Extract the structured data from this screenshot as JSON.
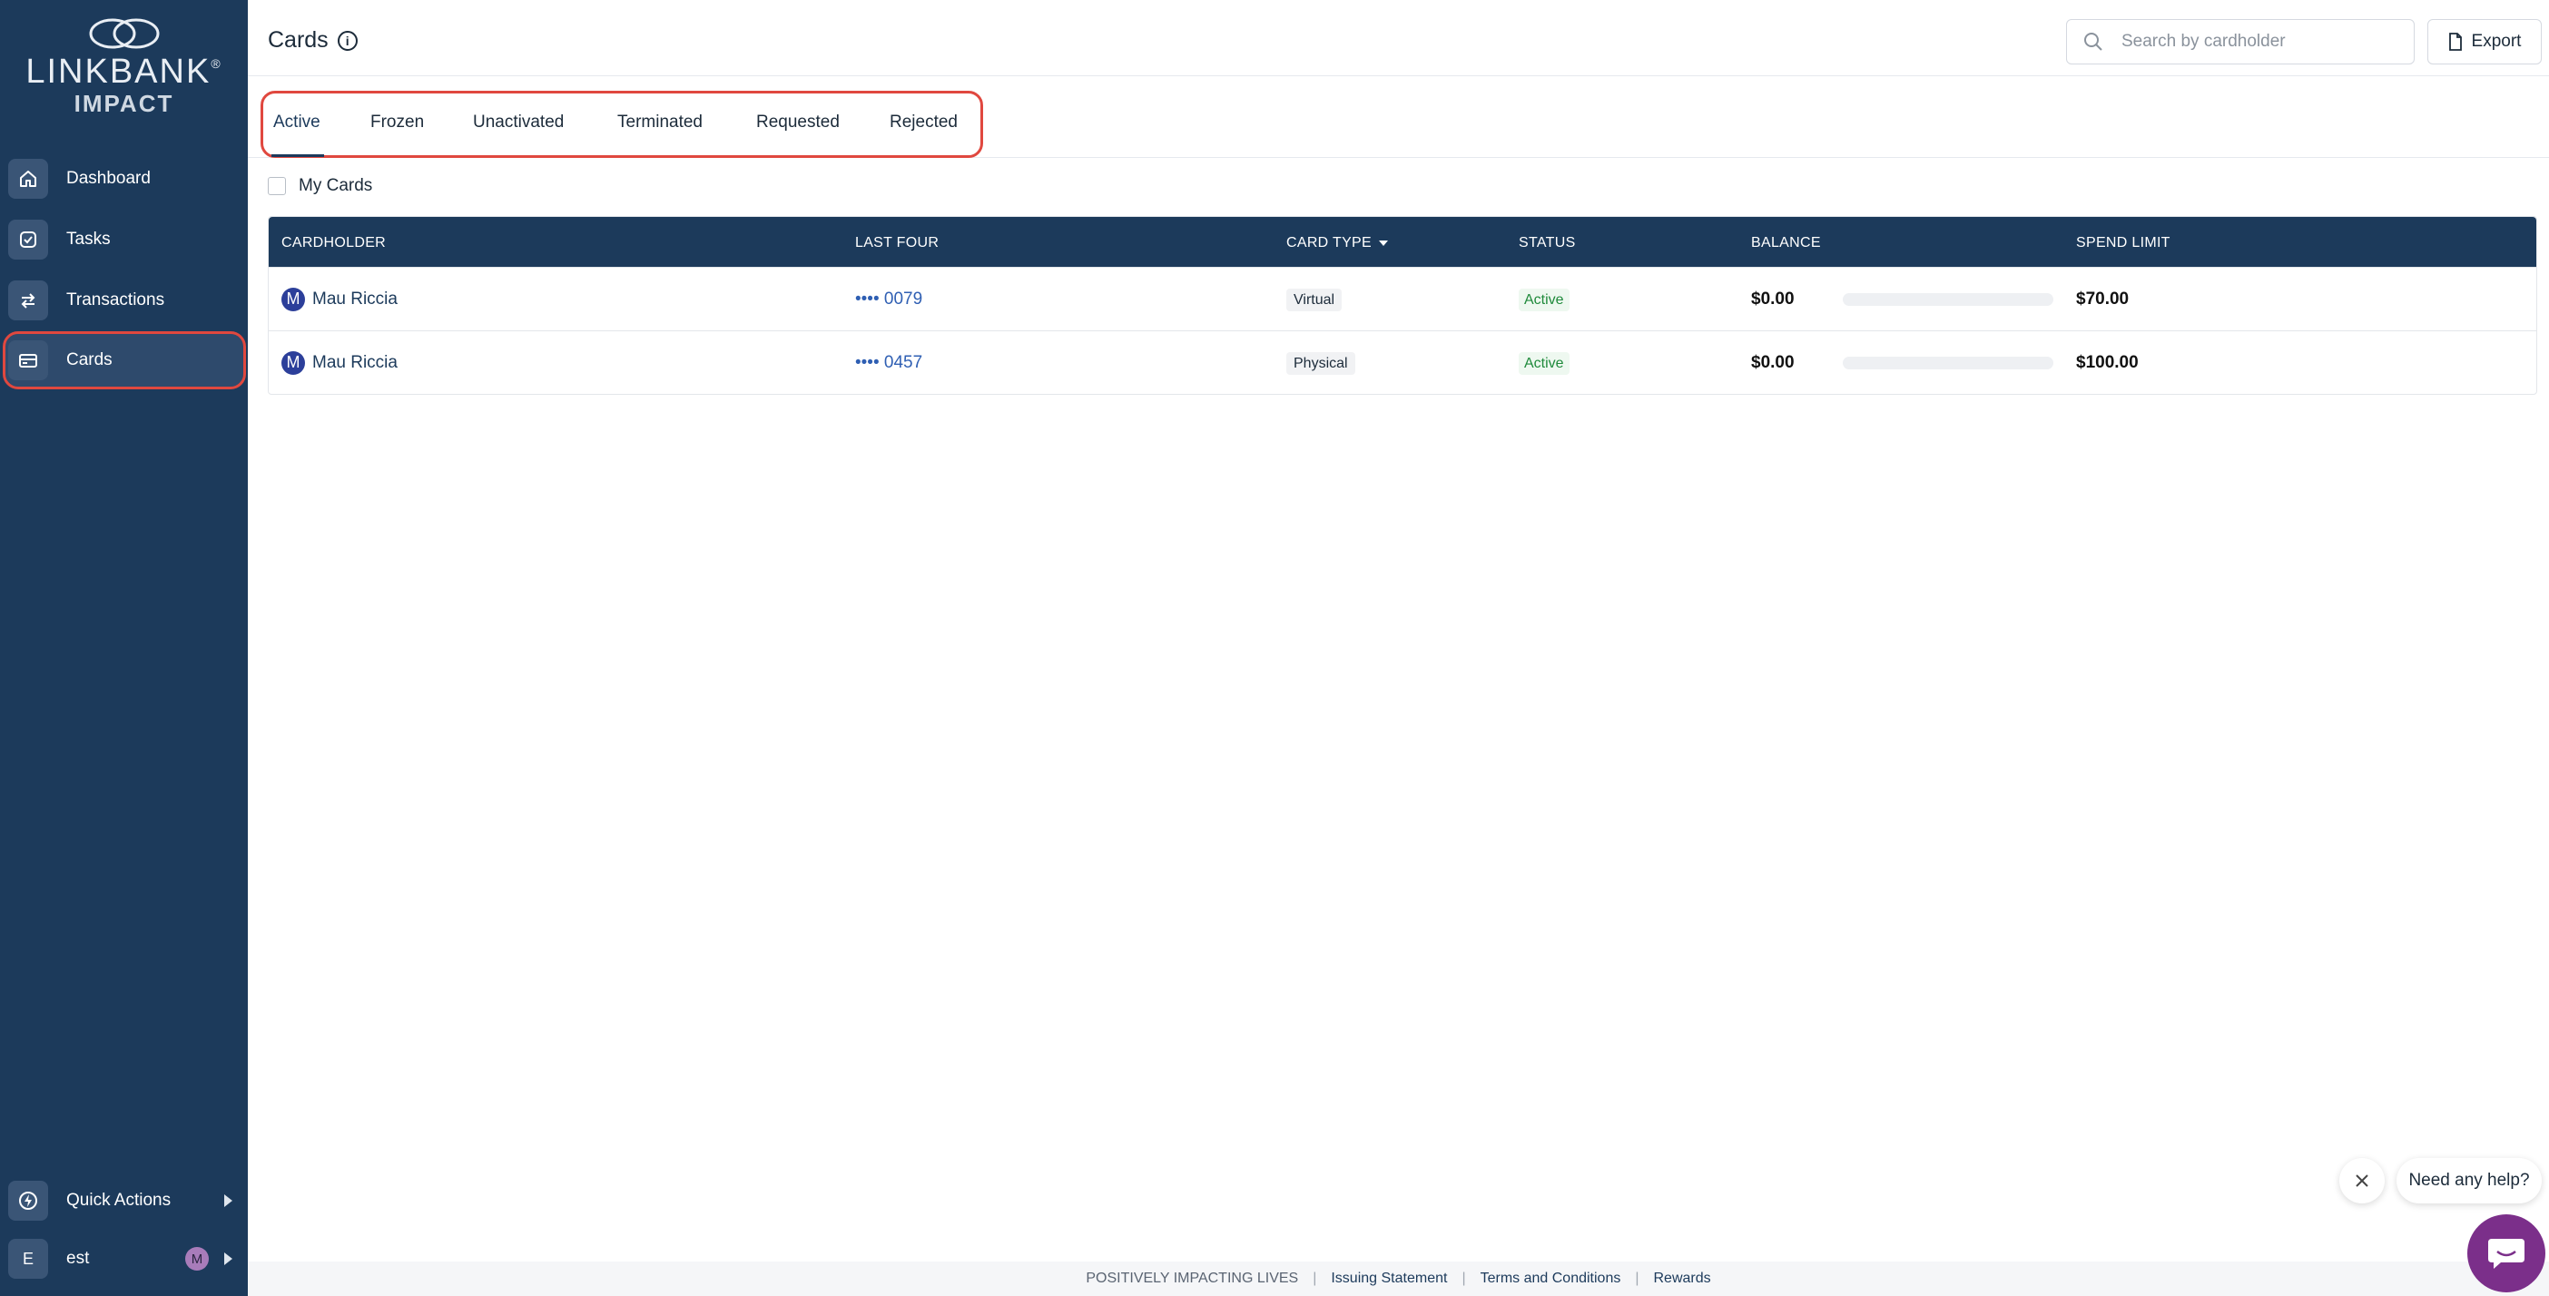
{
  "logo": {
    "brand": "LINKBANK",
    "reg": "®",
    "sub": "IMPACT"
  },
  "sidebar": {
    "items": [
      {
        "label": "Dashboard",
        "icon": "home-icon"
      },
      {
        "label": "Tasks",
        "icon": "check-circle-icon"
      },
      {
        "label": "Transactions",
        "icon": "transfer-arrows-icon"
      },
      {
        "label": "Cards",
        "icon": "credit-card-icon",
        "active": true
      }
    ],
    "quick_actions": "Quick Actions",
    "user": {
      "initial": "E",
      "name": "est",
      "avatar_initial": "M"
    }
  },
  "header": {
    "title": "Cards",
    "search_placeholder": "Search by cardholder",
    "export_label": "Export"
  },
  "tabs": [
    "Active",
    "Frozen",
    "Unactivated",
    "Terminated",
    "Requested",
    "Rejected"
  ],
  "filter": {
    "my_cards_label": "My Cards"
  },
  "table": {
    "headers": [
      "CARDHOLDER",
      "LAST FOUR",
      "CARD TYPE",
      "STATUS",
      "BALANCE",
      "SPEND LIMIT"
    ],
    "rows": [
      {
        "initial": "M",
        "name": "Mau Riccia",
        "last_four": "•••• 0079",
        "card_type": "Virtual",
        "status": "Active",
        "balance": "$0.00",
        "spend_fraction": 0,
        "spend_limit": "$70.00"
      },
      {
        "initial": "M",
        "name": "Mau Riccia",
        "last_four": "•••• 0457",
        "card_type": "Physical",
        "status": "Active",
        "balance": "$0.00",
        "spend_fraction": 0,
        "spend_limit": "$100.00"
      }
    ]
  },
  "footer": {
    "tagline": "POSITIVELY IMPACTING LIVES",
    "links": [
      "Issuing Statement",
      "Terms and Conditions",
      "Rewards"
    ]
  },
  "help": {
    "bubble": "Need any help?"
  },
  "colors": {
    "sidebar": "#1c3a5b",
    "accent": "#e0483f",
    "help": "#7b2f8a",
    "status_active": "#1f8a3b"
  }
}
